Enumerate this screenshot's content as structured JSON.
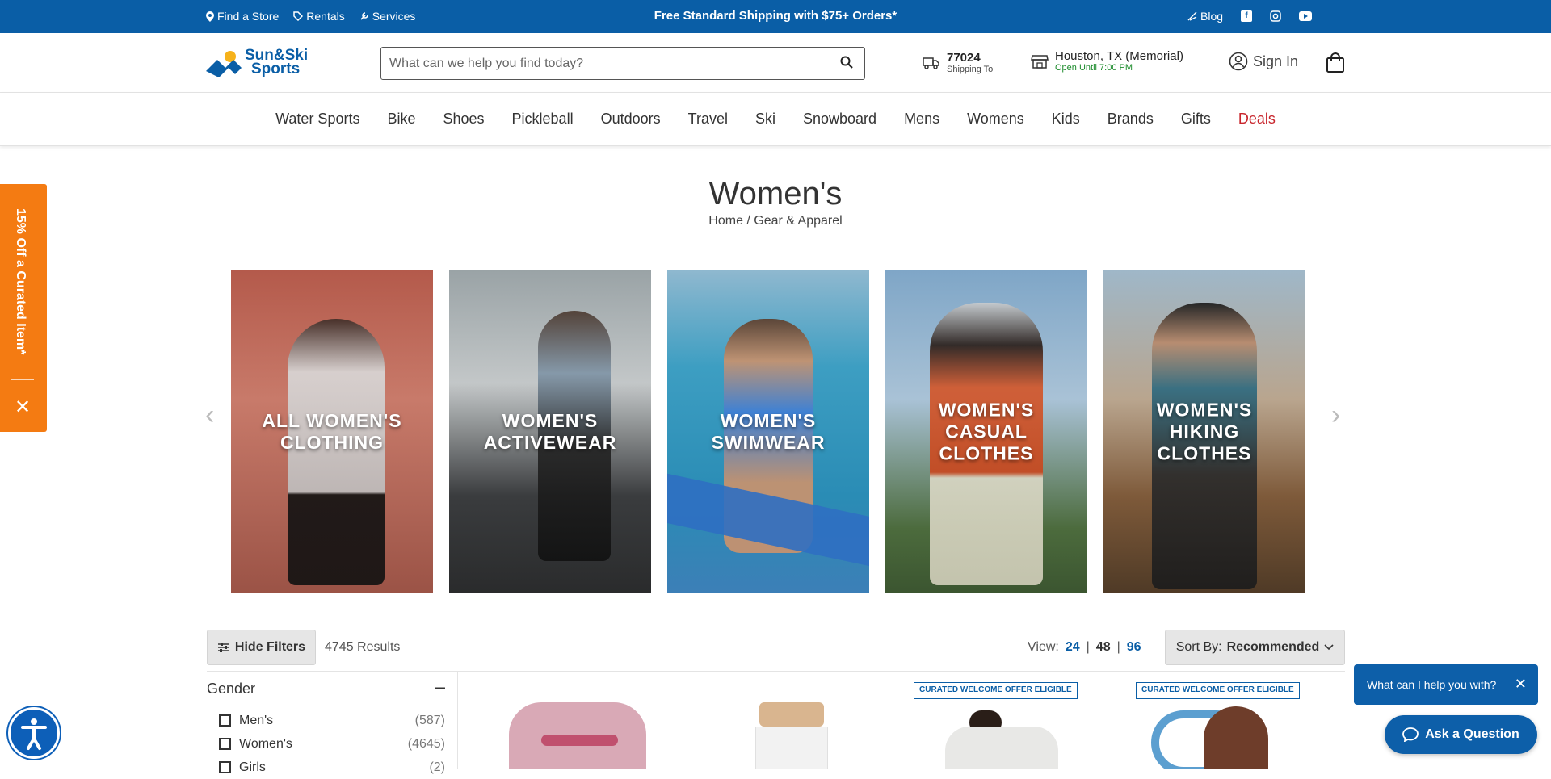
{
  "topbar": {
    "links": [
      "Find a Store",
      "Rentals",
      "Services"
    ],
    "promo": "Free Standard Shipping with $75+ Orders*",
    "blog": "Blog",
    "bg_color": "#0a5ea6"
  },
  "header": {
    "logo_line1": "Sun&Ski",
    "logo_line2": "Sports",
    "search_placeholder": "What can we help you find today?",
    "zip": "77024",
    "zip_sub": "Shipping To",
    "store_name": "Houston, TX (Memorial)",
    "store_hours": "Open Until 7:00 PM",
    "sign_in": "Sign In"
  },
  "nav": {
    "items": [
      "Water Sports",
      "Bike",
      "Shoes",
      "Pickleball",
      "Outdoors",
      "Travel",
      "Ski",
      "Snowboard",
      "Mens",
      "Womens",
      "Kids",
      "Brands",
      "Gifts",
      "Deals"
    ],
    "deals_color": "#c8252c"
  },
  "page": {
    "title": "Women's",
    "breadcrumb": "Home / Gear & Apparel"
  },
  "carousel": {
    "cards": [
      {
        "line1": "ALL WOMEN'S",
        "line2": "CLOTHING",
        "line3": ""
      },
      {
        "line1": "WOMEN'S",
        "line2": "ACTIVEWEAR",
        "line3": ""
      },
      {
        "line1": "WOMEN'S",
        "line2": "SWIMWEAR",
        "line3": ""
      },
      {
        "line1": "WOMEN'S",
        "line2": "CASUAL",
        "line3": "CLOTHES"
      },
      {
        "line1": "WOMEN'S",
        "line2": "HIKING",
        "line3": "CLOTHES"
      }
    ]
  },
  "listing": {
    "hide_filters": "Hide Filters",
    "results": "4745 Results",
    "view_label": "View:",
    "view_options": [
      "24",
      "48",
      "96"
    ],
    "sort_label": "Sort By:",
    "sort_value": "Recommended"
  },
  "facet": {
    "title": "Gender",
    "options": [
      {
        "label": "Men's",
        "count": "(587)"
      },
      {
        "label": "Women's",
        "count": "(4645)"
      },
      {
        "label": "Girls",
        "count": "(2)"
      }
    ]
  },
  "products": {
    "badge": "CURATED WELCOME OFFER ELIGIBLE"
  },
  "side_tab": {
    "label": "15% Off a Curated Item*",
    "color": "#f47b12"
  },
  "chat": {
    "prompt": "What can I help you with?",
    "button": "Ask a Question"
  }
}
